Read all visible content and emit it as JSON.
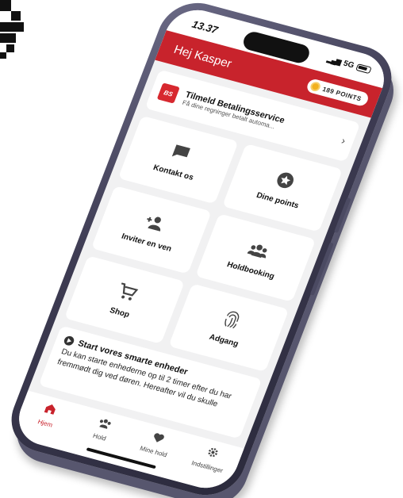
{
  "status_bar": {
    "time": "13.37",
    "network": "5G"
  },
  "header": {
    "greeting": "Hej Kasper",
    "points": "189 POINTS"
  },
  "banner": {
    "logo_text": "BS",
    "title": "Tilmeld Betalingsservice",
    "subtitle": "Få dine regninger betalt automa...",
    "chevron": "›"
  },
  "tiles": [
    {
      "label": "Kontakt os",
      "icon": "chat-icon"
    },
    {
      "label": "Dine points",
      "icon": "star-badge-icon"
    },
    {
      "label": "Inviter en ven",
      "icon": "add-person-icon"
    },
    {
      "label": "Holdbooking",
      "icon": "group-icon"
    },
    {
      "label": "Shop",
      "icon": "cart-icon"
    },
    {
      "label": "Adgang",
      "icon": "fingerprint-icon"
    }
  ],
  "smart_devices": {
    "title": "Start vores smarte enheder",
    "body": "Du kan starte enhederne op til 2 timer efter du har fremmødt dig ved døren. Hereafter vil du skulle"
  },
  "tabbar": [
    {
      "label": "Hjem",
      "icon": "home-icon",
      "active": true
    },
    {
      "label": "Hold",
      "icon": "group-icon",
      "active": false
    },
    {
      "label": "Mine hold",
      "icon": "heart-icon",
      "active": false
    },
    {
      "label": "Indstillinger",
      "icon": "gear-icon",
      "active": false
    }
  ],
  "colors": {
    "brand_red": "#c8232c",
    "screen_bg": "#f1f1f2",
    "frame": "#3d3b52",
    "coin": "#f2b01e"
  }
}
